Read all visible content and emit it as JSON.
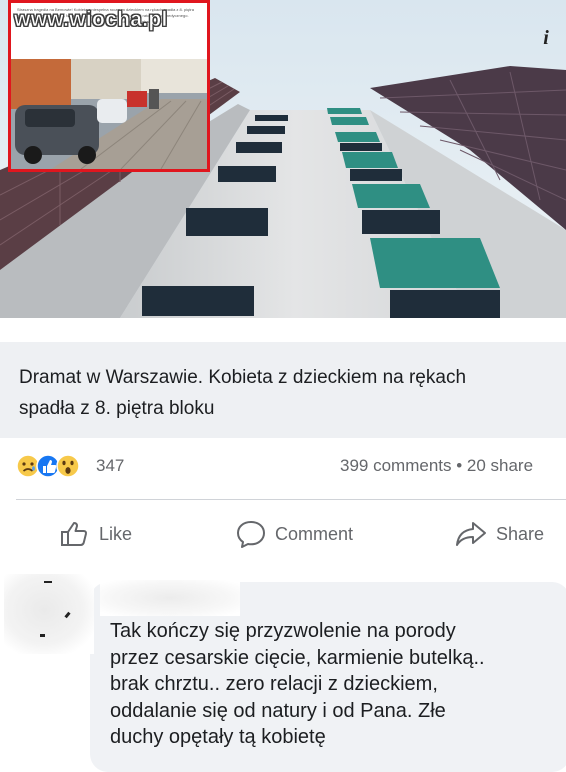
{
  "watermark": "www.wiocha.pl",
  "info_icon": "i",
  "inset": {
    "snippet": "Straszna tragedia na Bemowie! Kobieta z niespełna rocznym dzieckiem na rękach spadła z 8. piętra bloku przy ulicy Kaliskiego. Na miejscu pracowali strażacy, dwie załogi ratownictwa medycznego. Aktualnie swoje czynności prowadzi policja oraz policyjni technicy. ... Zobacz więcej"
  },
  "post": {
    "title_line1": "Dramat w Warszawie. Kobieta z dzieckiem na rękach",
    "title_line2": "spadła z 8. piętra bloku",
    "reaction_count": "347",
    "comments_shares": "399 comments • 20 share"
  },
  "actions": {
    "like": "Like",
    "comment": "Comment",
    "share": "Share"
  },
  "comment": {
    "text": "Tak kończy się przyzwolenie na porody\nprzez cesarskie cięcie, karmienie butelką..\nbrak chrztu.. zero relacji z dzieckiem,\noddalanie się od natury i od Pana. Złe\nduchy opętały tą kobietę"
  },
  "colors": {
    "inset_border": "#e0161e",
    "text_secondary": "#65676b",
    "title_background": "#eef0f3",
    "comment_bubble": "#f0f2f5"
  }
}
